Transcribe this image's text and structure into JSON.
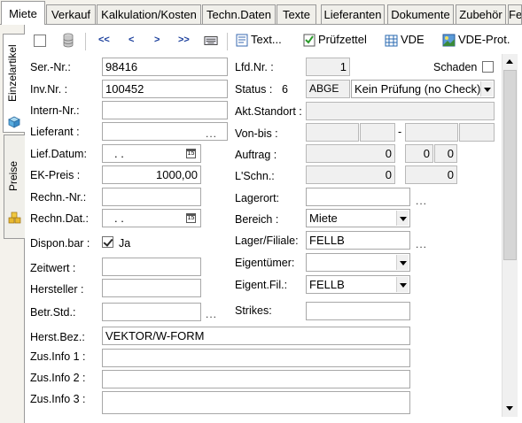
{
  "tabs": [
    {
      "label": "Miete",
      "active": true
    },
    {
      "label": "Verkauf"
    },
    {
      "label": "Kalkulation/Kosten"
    },
    {
      "label": "Techn.Daten"
    },
    {
      "label": "Texte"
    },
    {
      "label": "Lieferanten"
    },
    {
      "label": "Dokumente"
    },
    {
      "label": "Zubehör"
    },
    {
      "label": "Fe"
    }
  ],
  "side_tabs": [
    {
      "label": "Einzelartikel",
      "icon": "cube-icon",
      "active": true
    },
    {
      "label": "Preise",
      "icon": "coins-icon"
    }
  ],
  "toolbar": {
    "nav_first": "<<",
    "nav_prev": "<",
    "nav_next": ">",
    "nav_last": ">>",
    "text_label": "Text...",
    "pruefzettel_label": "Prüfzettel",
    "vde_label": "VDE",
    "vde_prot_label": "VDE-Prot."
  },
  "form": {
    "ser_nr": {
      "label": "Ser.-Nr.:",
      "value": "98416"
    },
    "inv_nr": {
      "label": "Inv.Nr. :",
      "value": "100452"
    },
    "intern_nr": {
      "label": "Intern-Nr.:",
      "value": ""
    },
    "lieferant": {
      "label": "Lieferant :",
      "value": "",
      "more": "..."
    },
    "lief_datum": {
      "label": "Lief.Datum:",
      "value": ". .",
      "cal": "15"
    },
    "ek_preis": {
      "label": "EK-Preis :",
      "value": "1000,00"
    },
    "rechn_nr": {
      "label": "Rechn.-Nr.:",
      "value": ""
    },
    "rechn_dat": {
      "label": "Rechn.Dat.:",
      "value": ". .",
      "cal": "15"
    },
    "dispon_bar": {
      "label": "Dispon.bar :",
      "checked": true,
      "text": "Ja"
    },
    "zeitwert": {
      "label": "Zeitwert :",
      "value": ""
    },
    "hersteller": {
      "label": "Hersteller :",
      "value": ""
    },
    "betr_std": {
      "label": "Betr.Std.:",
      "value": "",
      "more": "..."
    },
    "lfd_nr": {
      "label": "Lfd.Nr. :",
      "value": "1"
    },
    "schaden": {
      "label": "Schaden",
      "checked": false
    },
    "status": {
      "label": "Status :",
      "code_num": "6",
      "code": "ABGE",
      "select": "Kein Prüfung (no Check)"
    },
    "akt_standort": {
      "label": "Akt.Standort :",
      "value": ""
    },
    "von_bis": {
      "label": "Von-bis :",
      "dash": "-"
    },
    "auftrag": {
      "label": "Auftrag :",
      "value": "0",
      "v2": "0",
      "v3": "0"
    },
    "lschn": {
      "label": "L'Schn.:",
      "value": "0",
      "v2": "0"
    },
    "lagerort": {
      "label": "Lagerort:",
      "value": "",
      "more": "..."
    },
    "bereich": {
      "label": "Bereich :",
      "value": "Miete"
    },
    "lager_filiale": {
      "label": "Lager/Filiale:",
      "value": "FELLB",
      "more": "..."
    },
    "eigentuemer": {
      "label": "Eigentümer:",
      "value": ""
    },
    "eigent_fil": {
      "label": "Eigent.Fil.:",
      "value": "FELLB"
    },
    "strikes": {
      "label": "Strikes:",
      "value": ""
    },
    "herst_bez": {
      "label": "Herst.Bez.:",
      "value": "VEKTOR/W-FORM"
    },
    "zus_info_1": {
      "label": "Zus.Info 1 :",
      "value": ""
    },
    "zus_info_2": {
      "label": "Zus.Info 2 :",
      "value": ""
    },
    "zus_info_3": {
      "label": "Zus.Info 3 :",
      "value": ""
    }
  },
  "colors": {
    "tab_bg": "#f0efea",
    "readonly_bg": "#f0f0f0",
    "nav_blue": "#1a3e9c"
  }
}
